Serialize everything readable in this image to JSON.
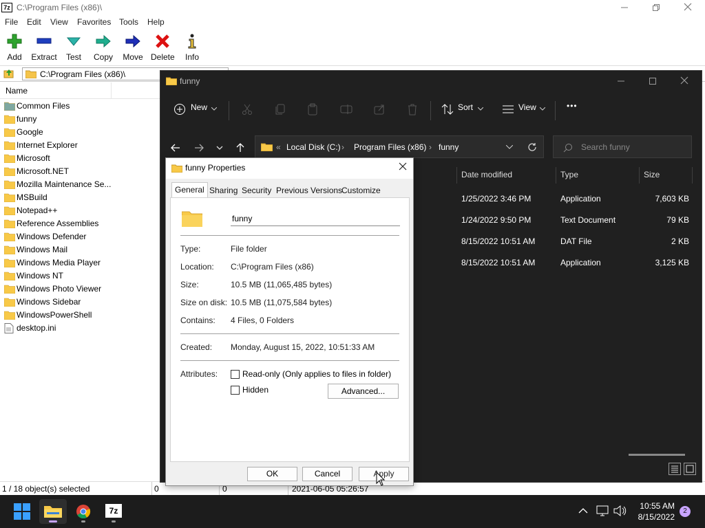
{
  "sevenzip": {
    "logo": "7z",
    "title": "C:\\Program Files (x86)\\",
    "menu": [
      "File",
      "Edit",
      "View",
      "Favorites",
      "Tools",
      "Help"
    ],
    "toolbar": [
      "Add",
      "Extract",
      "Test",
      "Copy",
      "Move",
      "Delete",
      "Info"
    ],
    "path": "C:\\Program Files (x86)\\",
    "column_name": "Name",
    "items": [
      {
        "name": "Common Files",
        "icon": "folder-icon"
      },
      {
        "name": "funny",
        "icon": "folder-icon"
      },
      {
        "name": "Google",
        "icon": "folder-icon"
      },
      {
        "name": "Internet Explorer",
        "icon": "folder-icon"
      },
      {
        "name": "Microsoft",
        "icon": "folder-icon"
      },
      {
        "name": "Microsoft.NET",
        "icon": "folder-icon"
      },
      {
        "name": "Mozilla Maintenance Se...",
        "icon": "folder-icon"
      },
      {
        "name": "MSBuild",
        "icon": "folder-icon"
      },
      {
        "name": "Notepad++",
        "icon": "folder-icon"
      },
      {
        "name": "Reference Assemblies",
        "icon": "folder-icon"
      },
      {
        "name": "Windows Defender",
        "icon": "folder-icon"
      },
      {
        "name": "Windows Mail",
        "icon": "folder-icon"
      },
      {
        "name": "Windows Media Player",
        "icon": "folder-icon"
      },
      {
        "name": "Windows NT",
        "icon": "folder-icon"
      },
      {
        "name": "Windows Photo Viewer",
        "icon": "folder-icon"
      },
      {
        "name": "Windows Sidebar",
        "icon": "folder-icon"
      },
      {
        "name": "WindowsPowerShell",
        "icon": "folder-icon"
      },
      {
        "name": "desktop.ini",
        "icon": "file-icon"
      }
    ],
    "status": {
      "selected": "1 / 18 object(s) selected",
      "cell2": "0",
      "cell3": "0",
      "cell4": "2021-06-05 05:26:57"
    }
  },
  "explorer": {
    "title": "funny",
    "commands": {
      "new": "New",
      "sort": "Sort",
      "view": "View",
      "more": "•••"
    },
    "breadcrumb": {
      "overflow": "«",
      "parts": [
        "Local Disk (C:)",
        "Program Files (x86)",
        "funny"
      ],
      "sep": "›"
    },
    "search_placeholder": "Search funny",
    "columns": [
      "Date modified",
      "Type",
      "Size"
    ],
    "rows": [
      {
        "date": "1/25/2022 3:46 PM",
        "type": "Application",
        "size": "7,603 KB"
      },
      {
        "date": "1/24/2022 9:50 PM",
        "type": "Text Document",
        "size": "79 KB"
      },
      {
        "date": "8/15/2022 10:51 AM",
        "type": "DAT File",
        "size": "2 KB"
      },
      {
        "date": "8/15/2022 10:51 AM",
        "type": "Application",
        "size": "3,125 KB"
      }
    ]
  },
  "dialog": {
    "title": "funny Properties",
    "tabs": [
      "General",
      "Sharing",
      "Security",
      "Previous Versions",
      "Customize"
    ],
    "name_value": "funny",
    "props": [
      {
        "label": "Type:",
        "value": "File folder"
      },
      {
        "label": "Location:",
        "value": "C:\\Program Files (x86)"
      },
      {
        "label": "Size:",
        "value": "10.5 MB (11,065,485 bytes)"
      },
      {
        "label": "Size on disk:",
        "value": "10.5 MB (11,075,584 bytes)"
      },
      {
        "label": "Contains:",
        "value": "4 Files, 0 Folders"
      }
    ],
    "created_label": "Created:",
    "created_value": "Monday, August 15, 2022, 10:51:33 AM",
    "attributes_label": "Attributes:",
    "readonly_label": "Read-only (Only applies to files in folder)",
    "hidden_label": "Hidden",
    "advanced": "Advanced...",
    "ok": "OK",
    "cancel": "Cancel",
    "apply": "Apply"
  },
  "taskbar": {
    "time": "10:55 AM",
    "date": "8/15/2022",
    "badge": "2",
    "sevenzip_label": "7z"
  },
  "colors": {
    "accent": "#0078d4",
    "folder": "#f8c948",
    "explorer_bg": "#202020",
    "taskbar_bg": "#1c1c1c"
  }
}
